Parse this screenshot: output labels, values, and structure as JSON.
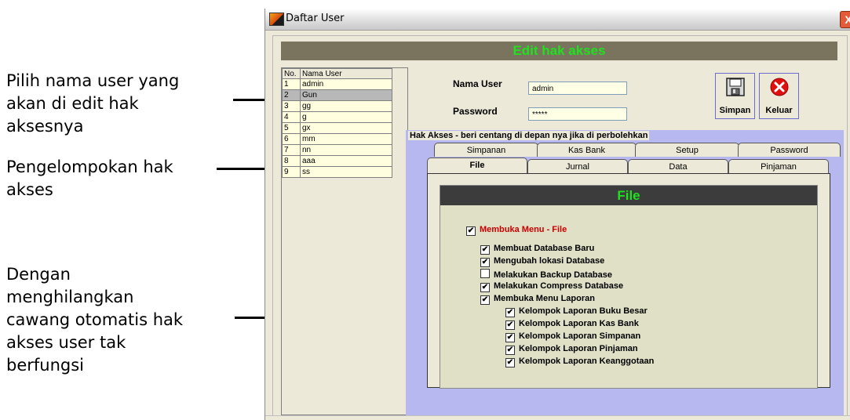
{
  "annotations": [
    "Pilih nama user yang\nakan di edit hak\naksesnya",
    "Pengelompokan  hak\nakses",
    "Dengan\nmenghilangkan\ncawang otomatis hak\nakses user tak\nberfungsi"
  ],
  "window": {
    "title": "Daftar User",
    "close_glyph": "X"
  },
  "banner": "Edit hak akses",
  "user_grid": {
    "headers": [
      "No.",
      "Nama User"
    ],
    "rows": [
      [
        "1",
        "admin"
      ],
      [
        "2",
        "Gun"
      ],
      [
        "3",
        "gg"
      ],
      [
        "4",
        "g"
      ],
      [
        "5",
        "gx"
      ],
      [
        "6",
        "mm"
      ],
      [
        "7",
        "nn"
      ],
      [
        "8",
        "aaa"
      ],
      [
        "9",
        "ss"
      ]
    ],
    "selected_row": 1
  },
  "form": {
    "name_label": "Nama User",
    "name_value": "admin",
    "password_label": "Password",
    "password_value": "*****"
  },
  "buttons": {
    "save": "Simpan",
    "exit": "Keluar"
  },
  "group_caption": "Hak Akses - beri centang di depan nya jika di perbolehkan",
  "tabs_back": [
    "Simpanan",
    "Kas Bank",
    "Setup",
    "Password"
  ],
  "tabs_front": [
    "File",
    "Jurnal",
    "Data",
    "Pinjaman"
  ],
  "active_tab": "File",
  "page_header": "File",
  "permissions": [
    {
      "label": "Membuka Menu - File",
      "checked": true,
      "level": 0,
      "red": true
    },
    {
      "label": "Membuat Database Baru",
      "checked": true,
      "level": 1
    },
    {
      "label": "Mengubah lokasi Database",
      "checked": true,
      "level": 1
    },
    {
      "label": "Melakukan Backup Database",
      "checked": false,
      "level": 1
    },
    {
      "label": "Melakukan Compress Database",
      "checked": true,
      "level": 1
    },
    {
      "label": "Membuka Menu Laporan",
      "checked": true,
      "level": 1
    },
    {
      "label": "Kelompok Laporan Buku Besar",
      "checked": true,
      "level": 2
    },
    {
      "label": "Kelompok Laporan Kas Bank",
      "checked": true,
      "level": 2
    },
    {
      "label": "Kelompok Laporan Simpanan",
      "checked": true,
      "level": 2
    },
    {
      "label": "Kelompok Laporan Pinjaman",
      "checked": true,
      "level": 2
    },
    {
      "label": "Kelompok Laporan Keanggotaan",
      "checked": true,
      "level": 2
    }
  ],
  "colors": {
    "banner_text": "#20e020",
    "selection": "#b8b8b8",
    "group_bg": "#b7b8f0"
  }
}
